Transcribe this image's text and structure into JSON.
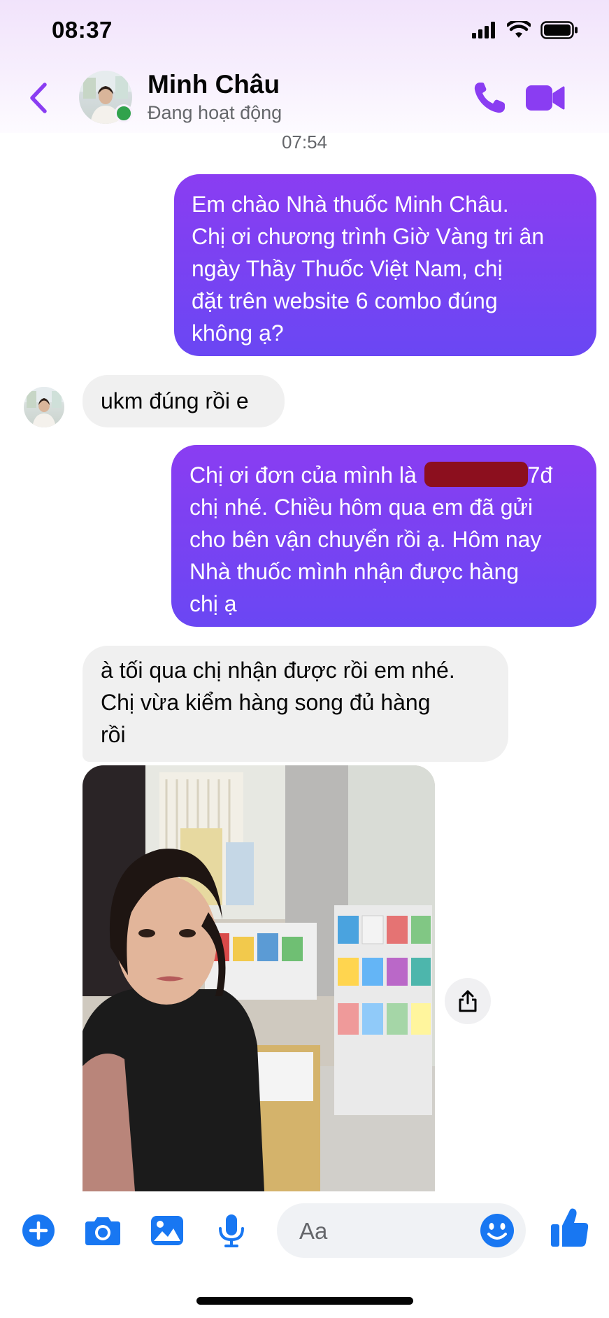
{
  "status_bar": {
    "time": "08:37"
  },
  "header": {
    "contact_name": "Minh Châu",
    "contact_status": "Đang hoạt động"
  },
  "thread": {
    "timestamp": "07:54",
    "messages": [
      {
        "from": "me",
        "lines": [
          "Em chào Nhà thuốc Minh Châu.",
          "Chị ơi chương trình Giờ Vàng tri ân",
          "ngày Thầy Thuốc Việt Nam, chị",
          "đặt trên website 6 combo đúng",
          "không ạ?"
        ]
      },
      {
        "from": "contact",
        "lines": [
          "ukm đúng rồi e"
        ]
      },
      {
        "from": "me",
        "line1_before": "Chị ơi đơn của mình là",
        "line1_after": "7đ",
        "lines_rest": [
          "chị nhé. Chiều hôm qua em đã gửi",
          "cho bên vận chuyển rồi ạ. Hôm nay",
          "Nhà thuốc mình nhận được hàng",
          "chị ạ"
        ]
      },
      {
        "from": "contact",
        "lines": [
          "à tối qua chị nhận được rồi em nhé.",
          "Chị vừa kiểm hàng song đủ hàng",
          "rồi"
        ]
      }
    ]
  },
  "composer": {
    "placeholder": "Aa"
  },
  "colors": {
    "accent": "#8a3df2",
    "bubble_gradient_end": "#6a47f3",
    "tool_blue": "#1877f2",
    "online": "#31a24c"
  },
  "icons": [
    "back-chevron-icon",
    "phone-icon",
    "video-camera-icon",
    "plus-circle-icon",
    "camera-icon",
    "gallery-icon",
    "microphone-icon",
    "emoji-icon",
    "thumbs-up-icon",
    "share-icon",
    "signal-icon",
    "wifi-icon",
    "battery-icon"
  ]
}
